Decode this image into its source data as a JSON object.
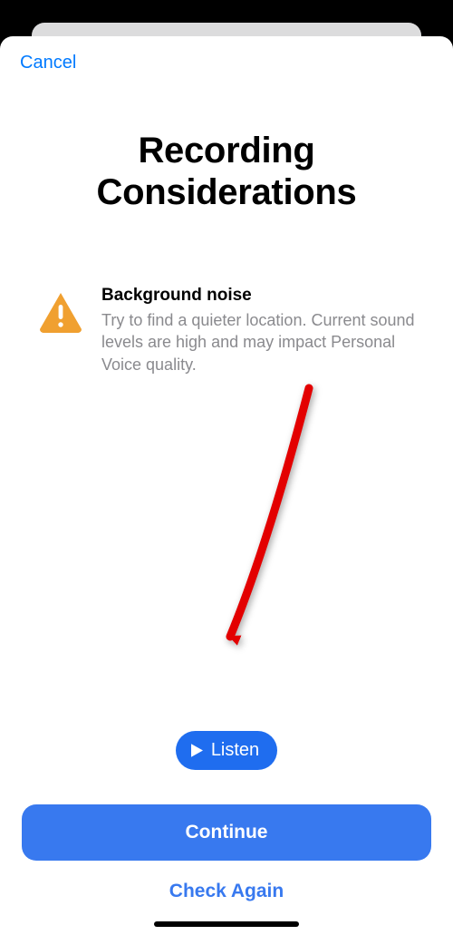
{
  "nav": {
    "cancel": "Cancel"
  },
  "title_line1": "Recording",
  "title_line2": "Considerations",
  "consideration": {
    "heading": "Background noise",
    "body": "Try to find a quieter location. Current sound levels are high and may impact Personal Voice quality."
  },
  "listen_label": "Listen",
  "continue_label": "Continue",
  "check_again_label": "Check Again",
  "colors": {
    "accent": "#3879ef",
    "link": "#007aff",
    "warning": "#f0a030"
  }
}
